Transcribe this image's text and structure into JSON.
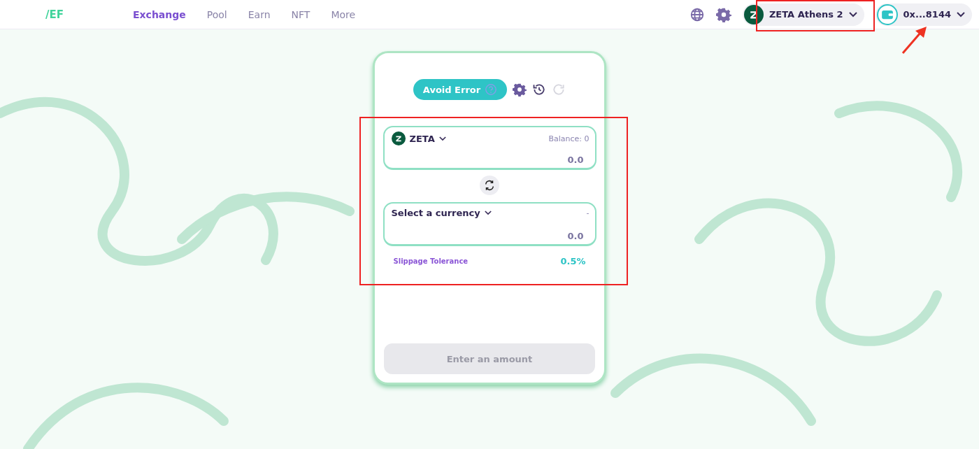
{
  "header": {
    "logo": "/EF",
    "nav": [
      {
        "label": "Exchange",
        "selected": true
      },
      {
        "label": "Pool",
        "selected": false
      },
      {
        "label": "Earn",
        "selected": false
      },
      {
        "label": "NFT",
        "selected": false
      },
      {
        "label": "More",
        "selected": false
      }
    ],
    "network": {
      "label": "ZETA Athens 2"
    },
    "wallet": {
      "address": "0x...8144"
    }
  },
  "swap": {
    "avoid_error": {
      "label": "Avoid Error"
    },
    "from": {
      "token": "ZETA",
      "balance": "Balance: 0",
      "amount": "0.0"
    },
    "to": {
      "token": "Select a currency",
      "balance": "-",
      "amount": "0.0"
    },
    "slippage": {
      "label": "Slippage Tolerance",
      "value": "0.5%"
    },
    "submit": {
      "label": "Enter an amount",
      "disabled": true
    }
  }
}
